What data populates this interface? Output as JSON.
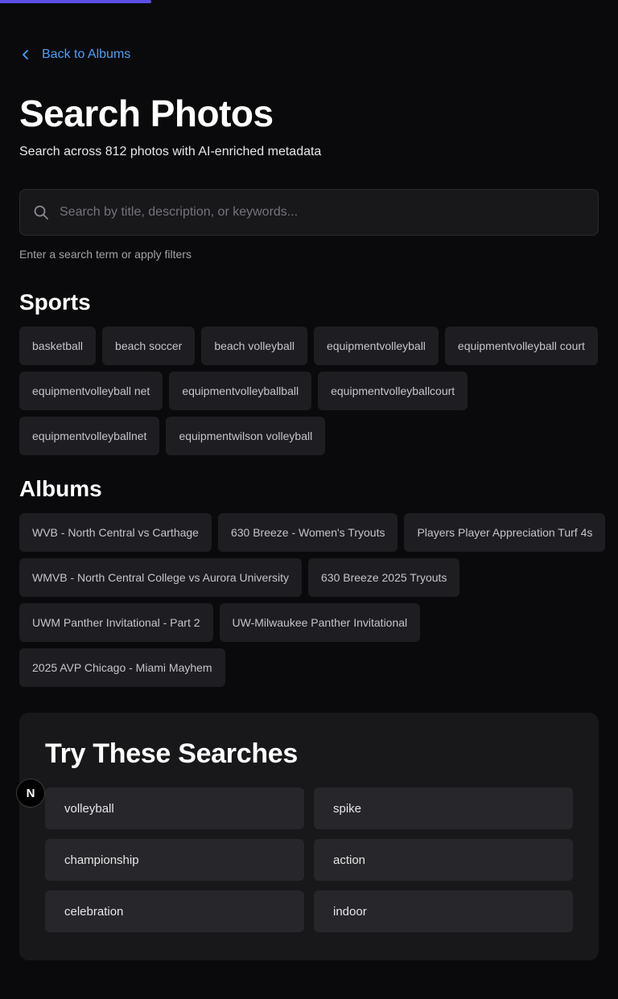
{
  "nav": {
    "back_label": "Back to Albums"
  },
  "header": {
    "title": "Search Photos",
    "subtitle": "Search across 812 photos with AI-enriched metadata"
  },
  "search": {
    "value": "",
    "placeholder": "Search by title, description, or keywords...",
    "hint": "Enter a search term or apply filters"
  },
  "sports": {
    "heading": "Sports",
    "items": [
      "basketball",
      "beach soccer",
      "beach volleyball",
      "equipmentvolleyball",
      "equipmentvolleyball court",
      "equipmentvolleyball net",
      "equipmentvolleyballball",
      "equipmentvolleyballcourt",
      "equipmentvolleyballnet",
      "equipmentwilson volleyball"
    ]
  },
  "albums": {
    "heading": "Albums",
    "items": [
      "WVB - North Central vs Carthage",
      "630 Breeze - Women's Tryouts",
      "Players Player Appreciation Turf 4s",
      "WMVB - North Central College vs Aurora University",
      "630 Breeze 2025 Tryouts",
      "UWM Panther Invitational - Part 2",
      "UW-Milwaukee Panther Invitational",
      "2025 AVP Chicago - Miami Mayhem"
    ]
  },
  "try_searches": {
    "title": "Try These Searches",
    "items": [
      "volleyball",
      "spike",
      "championship",
      "action",
      "celebration",
      "indoor"
    ]
  },
  "badge": {
    "label": "N"
  },
  "colors": {
    "background": "#0a0a0c",
    "accent_link": "#4d9ff5",
    "progress": "#5b4fe6",
    "chip_bg": "#1e1e22",
    "panel_bg": "#18181b"
  },
  "icons": {
    "back": "chevron-left-icon",
    "search": "search-icon"
  }
}
